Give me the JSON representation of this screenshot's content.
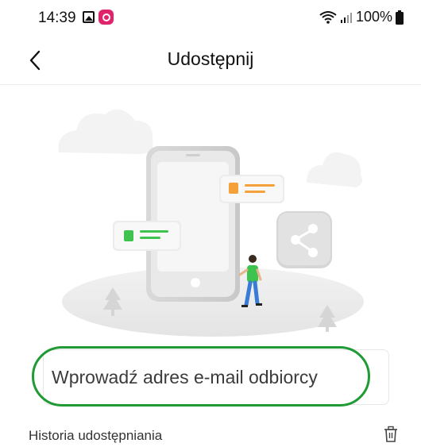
{
  "status_bar": {
    "time": "14:39",
    "battery_text": "100%",
    "icons": [
      "gallery-icon",
      "instagram-icon",
      "wifi-icon",
      "signal-icon",
      "battery-icon"
    ]
  },
  "header": {
    "title": "Udostępnij",
    "back_icon": "chevron-left-icon"
  },
  "illustration": {
    "description_icon": "share-icon"
  },
  "email_input": {
    "placeholder": "Wprowadź adres e-mail odbiorcy",
    "value": ""
  },
  "history": {
    "label": "Historia udostępniania",
    "action_icon": "trash-icon"
  },
  "colors": {
    "accent_green": "#1f9a34",
    "card_orange": "#f4a13a",
    "card_green": "#3ec34f"
  }
}
